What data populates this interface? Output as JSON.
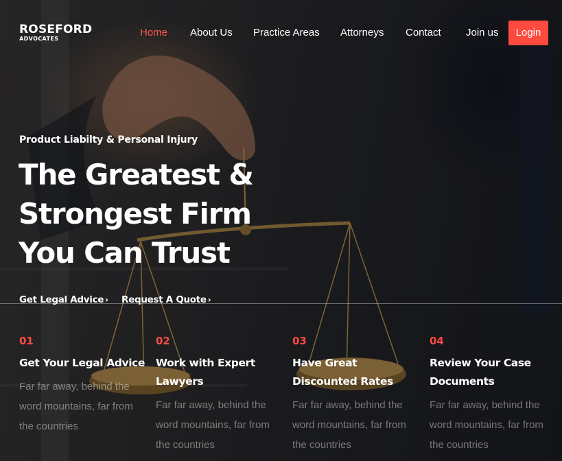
{
  "brand": {
    "name": "ROSEFORD",
    "sub": "ADVOCATES"
  },
  "nav": {
    "items": [
      {
        "label": "Home",
        "active": true
      },
      {
        "label": "About Us",
        "active": false
      },
      {
        "label": "Practice Areas",
        "active": false
      },
      {
        "label": "Attorneys",
        "active": false
      },
      {
        "label": "Contact",
        "active": false
      },
      {
        "label": "Join us",
        "active": false
      }
    ],
    "login_label": "Login"
  },
  "hero": {
    "eyebrow": "Product Liabilty & Personal Injury",
    "headline": [
      "The Greatest &",
      "Strongest Firm",
      "You Can Trust"
    ],
    "cta_advice": "Get Legal Advice",
    "cta_quote": "Request A Quote"
  },
  "features": [
    {
      "num": "01",
      "title": "Get Your Legal Advice",
      "text": "Far far away, behind the word mountains, far from the countries"
    },
    {
      "num": "02",
      "title": "Work with Expert Lawyers",
      "text": "Far far away, behind the word mountains, far from the countries"
    },
    {
      "num": "03",
      "title": "Have Great Discounted Rates",
      "text": "Far far away, behind the word mountains, far from the countries"
    },
    {
      "num": "04",
      "title": "Review Your Case Documents",
      "text": "Far far away, behind the word mountains, far from the countries"
    }
  ],
  "colors": {
    "accent": "#ff4a40",
    "active_nav": "#ff5a4e",
    "text": "#ffffff",
    "muted_text": "rgba(255,255,255,0.42)"
  },
  "icons": {
    "cta_chevron": "chevron-right-icon"
  }
}
